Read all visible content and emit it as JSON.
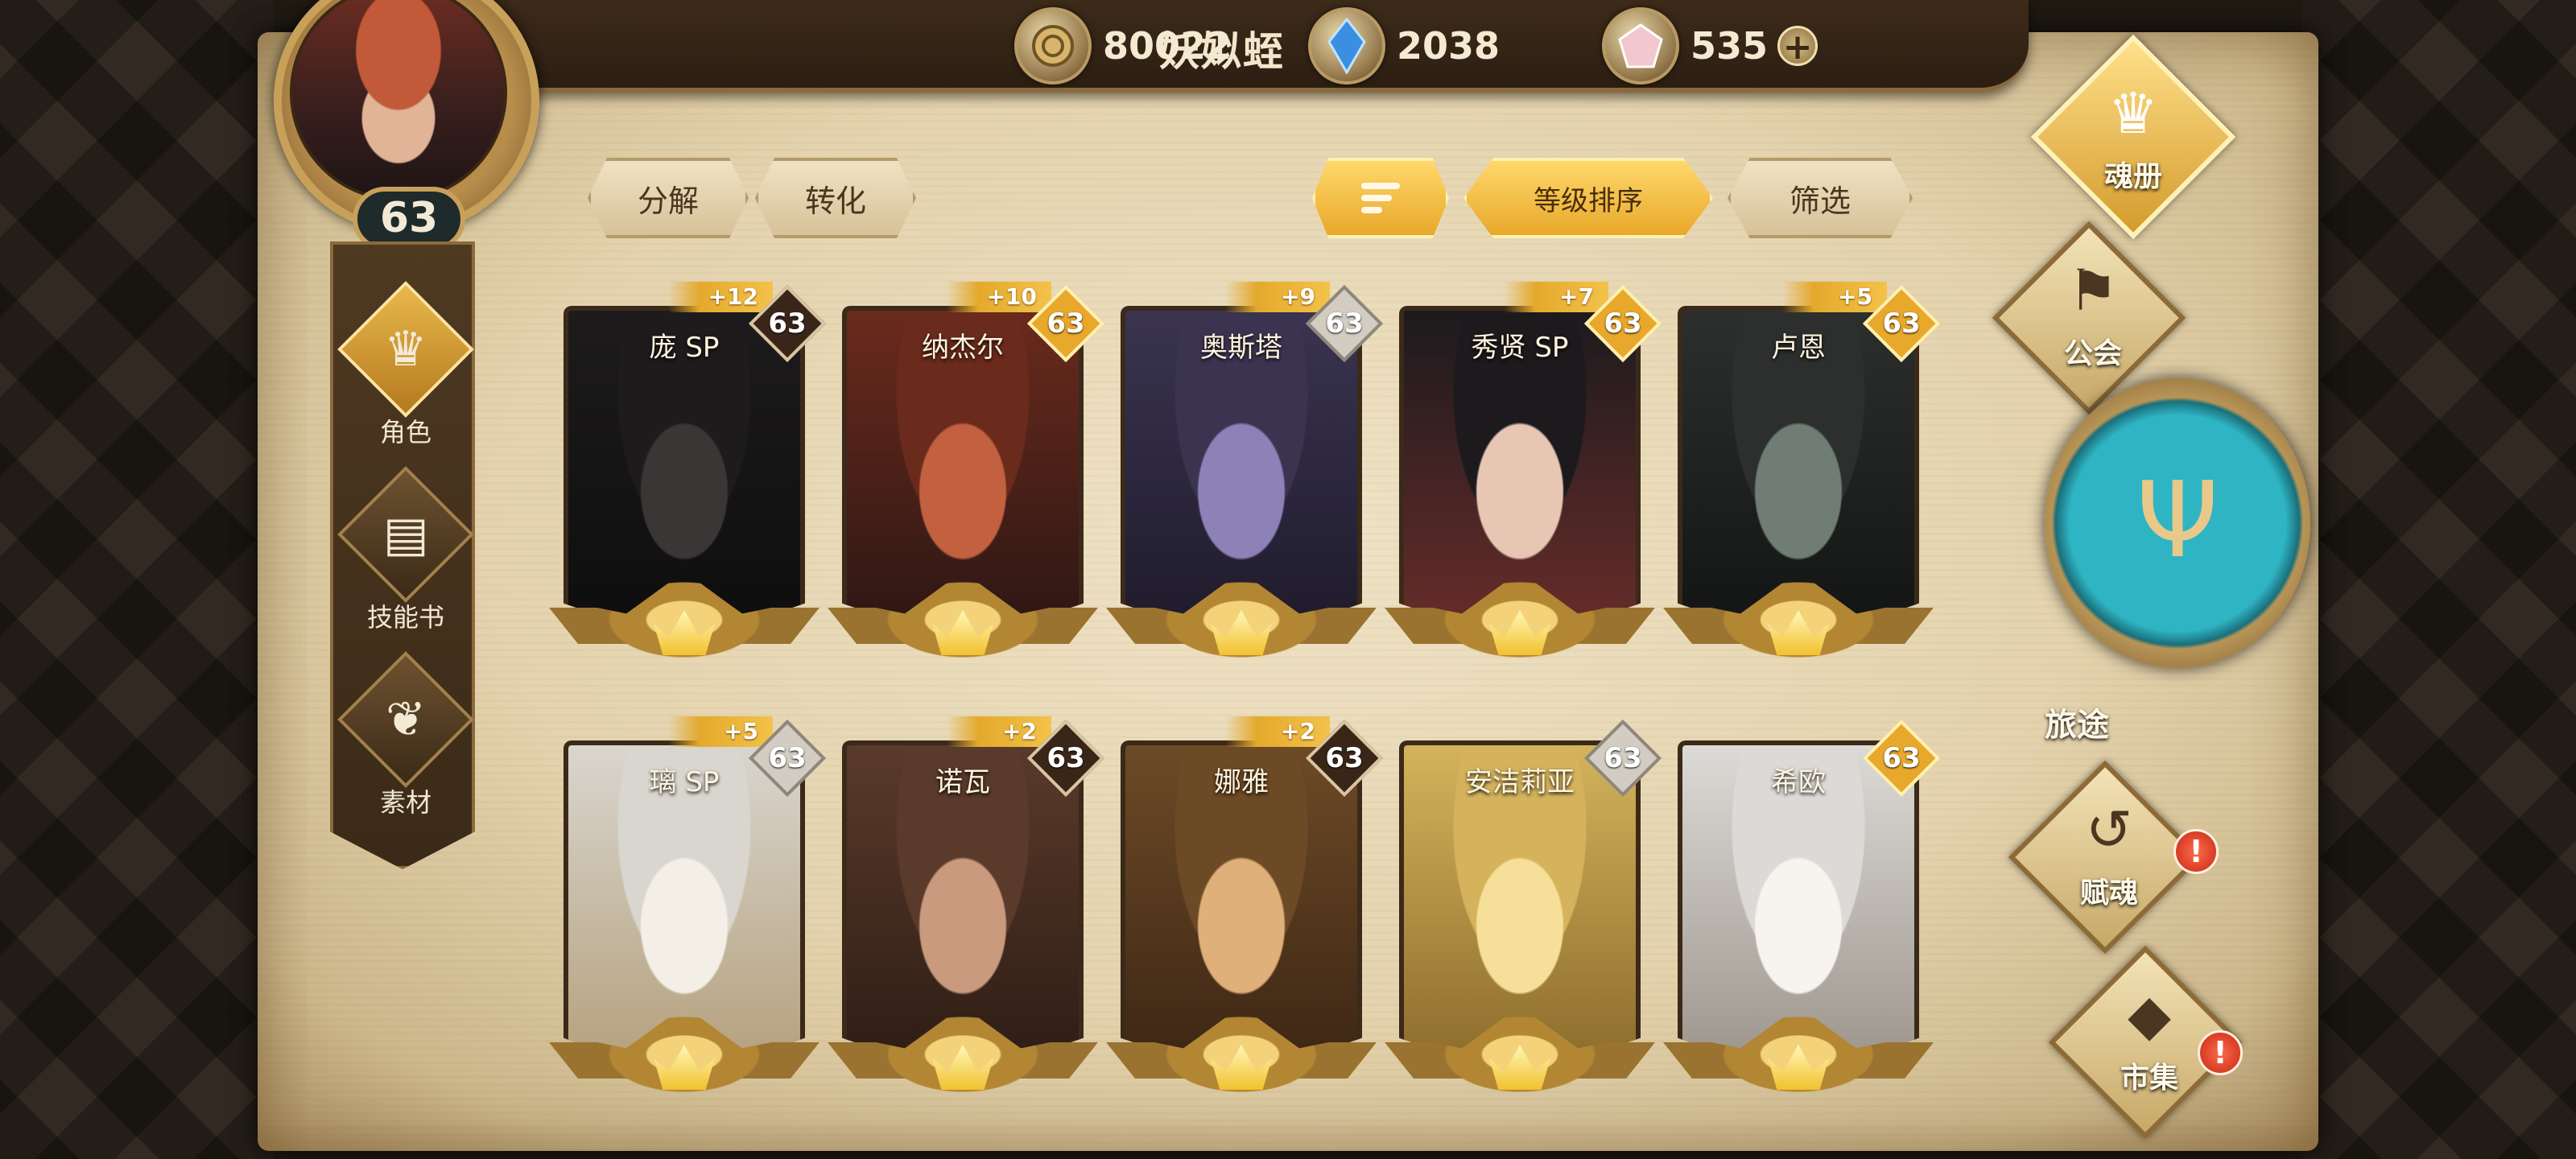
{
  "player": {
    "name": "妖姒蛭",
    "level": "63"
  },
  "currencies": [
    {
      "icon": "gold-coin-icon",
      "value": "80022"
    },
    {
      "icon": "blue-crystal-icon",
      "value": "2038"
    },
    {
      "icon": "pink-gem-icon",
      "value": "535"
    }
  ],
  "left_nav": {
    "items": [
      {
        "label": "角色",
        "icon": "character-icon"
      },
      {
        "label": "技能书",
        "icon": "skill-book-icon"
      },
      {
        "label": "素材",
        "icon": "material-icon"
      }
    ]
  },
  "toolbar": {
    "decompose": "分解",
    "convert": "转化",
    "sort_by_level": "等级排序",
    "filter": "筛选"
  },
  "cards": [
    {
      "name": "庞 SP",
      "level": "63",
      "plus": "+12",
      "badge": "dark"
    },
    {
      "name": "纳杰尔",
      "level": "63",
      "plus": "+10",
      "badge": "gold"
    },
    {
      "name": "奥斯塔",
      "level": "63",
      "plus": "+9",
      "badge": "silver"
    },
    {
      "name": "秀贤 SP",
      "level": "63",
      "plus": "+7",
      "badge": "gold"
    },
    {
      "name": "卢恩",
      "level": "63",
      "plus": "+5",
      "badge": "gold"
    },
    {
      "name": "璃 SP",
      "level": "63",
      "plus": "+5",
      "badge": "silver"
    },
    {
      "name": "诺瓦",
      "level": "63",
      "plus": "+2",
      "badge": "dark"
    },
    {
      "name": "娜雅",
      "level": "63",
      "plus": "+2",
      "badge": "dark"
    },
    {
      "name": "安洁莉亚",
      "level": "63",
      "plus": "",
      "badge": "silver"
    },
    {
      "name": "希欧",
      "level": "63",
      "plus": "",
      "badge": "gold"
    }
  ],
  "right_menu": {
    "soul_book": "魂册",
    "guild": "公会",
    "journey": "旅途",
    "bestow_soul": "赋魂",
    "market": "市集",
    "alert_mark": "!"
  },
  "colors": {
    "parchment": "#e4d3ae",
    "gold_accent": "#e8a82b",
    "dark_frame": "#2a2219",
    "journey_teal": "#2fb4c4"
  }
}
